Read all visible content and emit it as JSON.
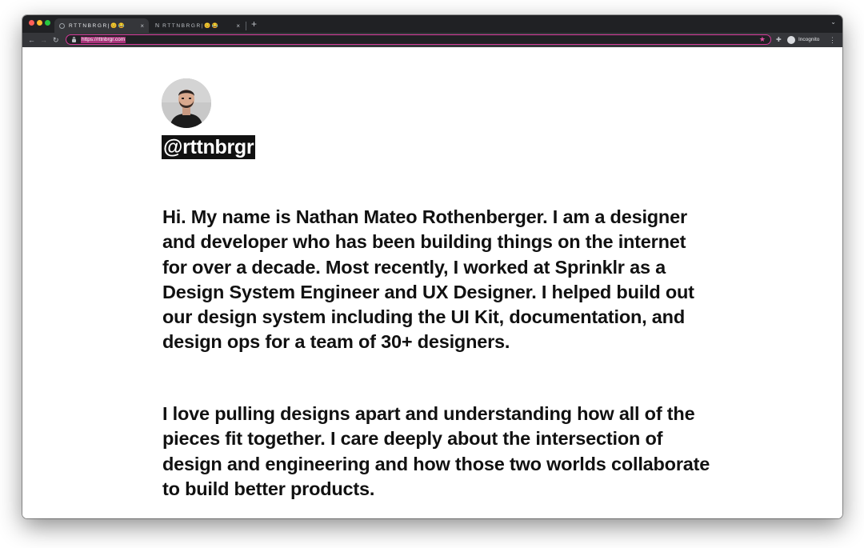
{
  "browser": {
    "tabs": [
      {
        "title": "RTTNBRGR|😊😂",
        "active": true,
        "close": "×"
      },
      {
        "title": "RTTNBRGR|😊😂",
        "active": false,
        "close": "×"
      }
    ],
    "new_tab": "+",
    "tab_search": "⌄",
    "url": "https://rttnbrgr.com",
    "profile_label": "Incognito",
    "accent_color": "#d63a9a"
  },
  "page": {
    "handle": "@rttnbrgr",
    "bio": [
      "Hi. My name is Nathan Mateo Rothenberger. I am a designer and developer who has been building things on the internet for over a decade. Most recently, I worked at Sprinklr as a Design System Engineer and UX Designer. I helped build out our design system including the UI Kit, documentation, and design ops for a team of 30+ designers.",
      "I love pulling designs apart and understanding how all of the pieces fit together. I care deeply about the intersection of design and engineering and how those two worlds collaborate to build better products."
    ]
  },
  "icons": {
    "favicon": "globe-icon",
    "back": "arrow-left-icon",
    "forward": "arrow-right-icon",
    "reload": "reload-icon",
    "lock": "lock-icon",
    "star": "star-icon",
    "extensions": "puzzle-icon",
    "incognito": "incognito-icon",
    "menu": "kebab-menu-icon"
  }
}
